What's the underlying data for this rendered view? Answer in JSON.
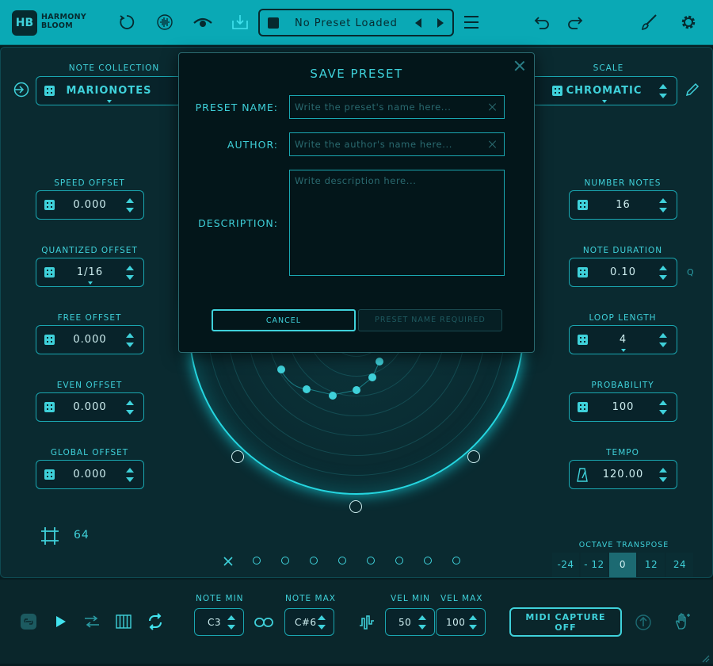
{
  "app": {
    "logo_short": "HB",
    "logo_line1": "HARMONY",
    "logo_line2": "BLOOM"
  },
  "toolbar": {
    "preset_name": "No Preset Loaded"
  },
  "left": {
    "note_collection_label": "NOTE COLLECTION",
    "note_collection_value": "MARIONOTES",
    "controls": [
      {
        "label": "SPEED OFFSET",
        "value": "0.000"
      },
      {
        "label": "QUANTIZED OFFSET",
        "value": "1/16"
      },
      {
        "label": "FREE OFFSET",
        "value": "0.000"
      },
      {
        "label": "EVEN OFFSET",
        "value": "0.000"
      },
      {
        "label": "GLOBAL OFFSET",
        "value": "0.000"
      }
    ],
    "grid_value": "64"
  },
  "right": {
    "scale_label": "SCALE",
    "scale_value": "CHROMATIC",
    "controls": [
      {
        "label": "NUMBER NOTES",
        "value": "16"
      },
      {
        "label": "NOTE DURATION",
        "value": "0.10"
      },
      {
        "label": "LOOP LENGTH",
        "value": "4"
      },
      {
        "label": "PROBABILITY",
        "value": "100"
      },
      {
        "label": "TEMPO",
        "value": "120.00"
      }
    ],
    "q_label": "Q"
  },
  "octave": {
    "label": "OCTAVE TRANSPOSE",
    "options": [
      "-24",
      "- 12",
      "0",
      "12",
      "24"
    ],
    "selected": "0"
  },
  "modal": {
    "title": "SAVE PRESET",
    "preset_name_label": "PRESET NAME:",
    "preset_name_placeholder": "Write the preset's name here...",
    "author_label": "AUTHOR:",
    "author_placeholder": "Write the author's name here...",
    "description_label": "DESCRIPTION:",
    "description_placeholder": "Write description here...",
    "cancel_label": "CANCEL",
    "save_label": "PRESET NAME REQUIRED"
  },
  "bottom": {
    "note_min_label": "NOTE MIN",
    "note_min": "C3",
    "note_max_label": "NOTE MAX",
    "note_max": "C#6",
    "vel_min_label": "VEL MIN",
    "vel_min": "50",
    "vel_max_label": "VEL MAX",
    "vel_max": "100",
    "midi_capture_line1": "MIDI CAPTURE",
    "midi_capture_line2": "OFF"
  },
  "colors": {
    "accent": "#3fd1da",
    "topbar": "#0aa9b5",
    "background": "#061d21"
  }
}
